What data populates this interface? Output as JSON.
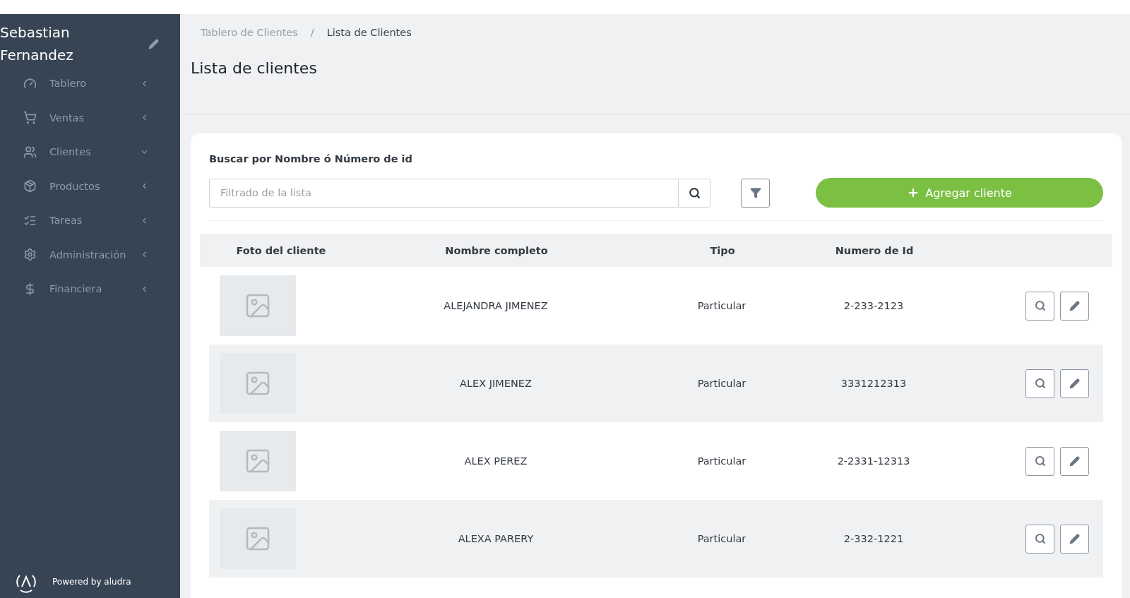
{
  "sidebar": {
    "user_name": "Sebastian Fernandez",
    "items": [
      {
        "label": "Tablero",
        "expanded": false
      },
      {
        "label": "Ventas",
        "expanded": false
      },
      {
        "label": "Clientes",
        "expanded": true
      },
      {
        "label": "Productos",
        "expanded": false
      },
      {
        "label": "Tareas",
        "expanded": false
      },
      {
        "label": "Administración",
        "expanded": false
      },
      {
        "label": "Financiera",
        "expanded": false
      }
    ],
    "footer": "Powered by aludra"
  },
  "breadcrumb_separator": "/",
  "breadcrumb": [
    {
      "label": "Tablero de Clientes",
      "current": false
    },
    {
      "label": "Lista de Clientes",
      "current": true
    }
  ],
  "page_title": "Lista de clientes",
  "search": {
    "label": "Buscar por Nombre ó Número de id",
    "placeholder": "Filtrado de la lista"
  },
  "add_button": "Agregar cliente",
  "table": {
    "columns": [
      "Foto del cliente",
      "Nombre completo",
      "Tipo",
      "Numero de Id"
    ],
    "rows": [
      {
        "name": "ALEJANDRA JIMENEZ",
        "type": "Particular",
        "id": "2-233-2123"
      },
      {
        "name": "ALEX JIMENEZ",
        "type": "Particular",
        "id": "3331212313"
      },
      {
        "name": "ALEX PEREZ",
        "type": "Particular",
        "id": "2-2331-12313"
      },
      {
        "name": "ALEXA PARERY",
        "type": "Particular",
        "id": "2-332-1221"
      }
    ]
  }
}
